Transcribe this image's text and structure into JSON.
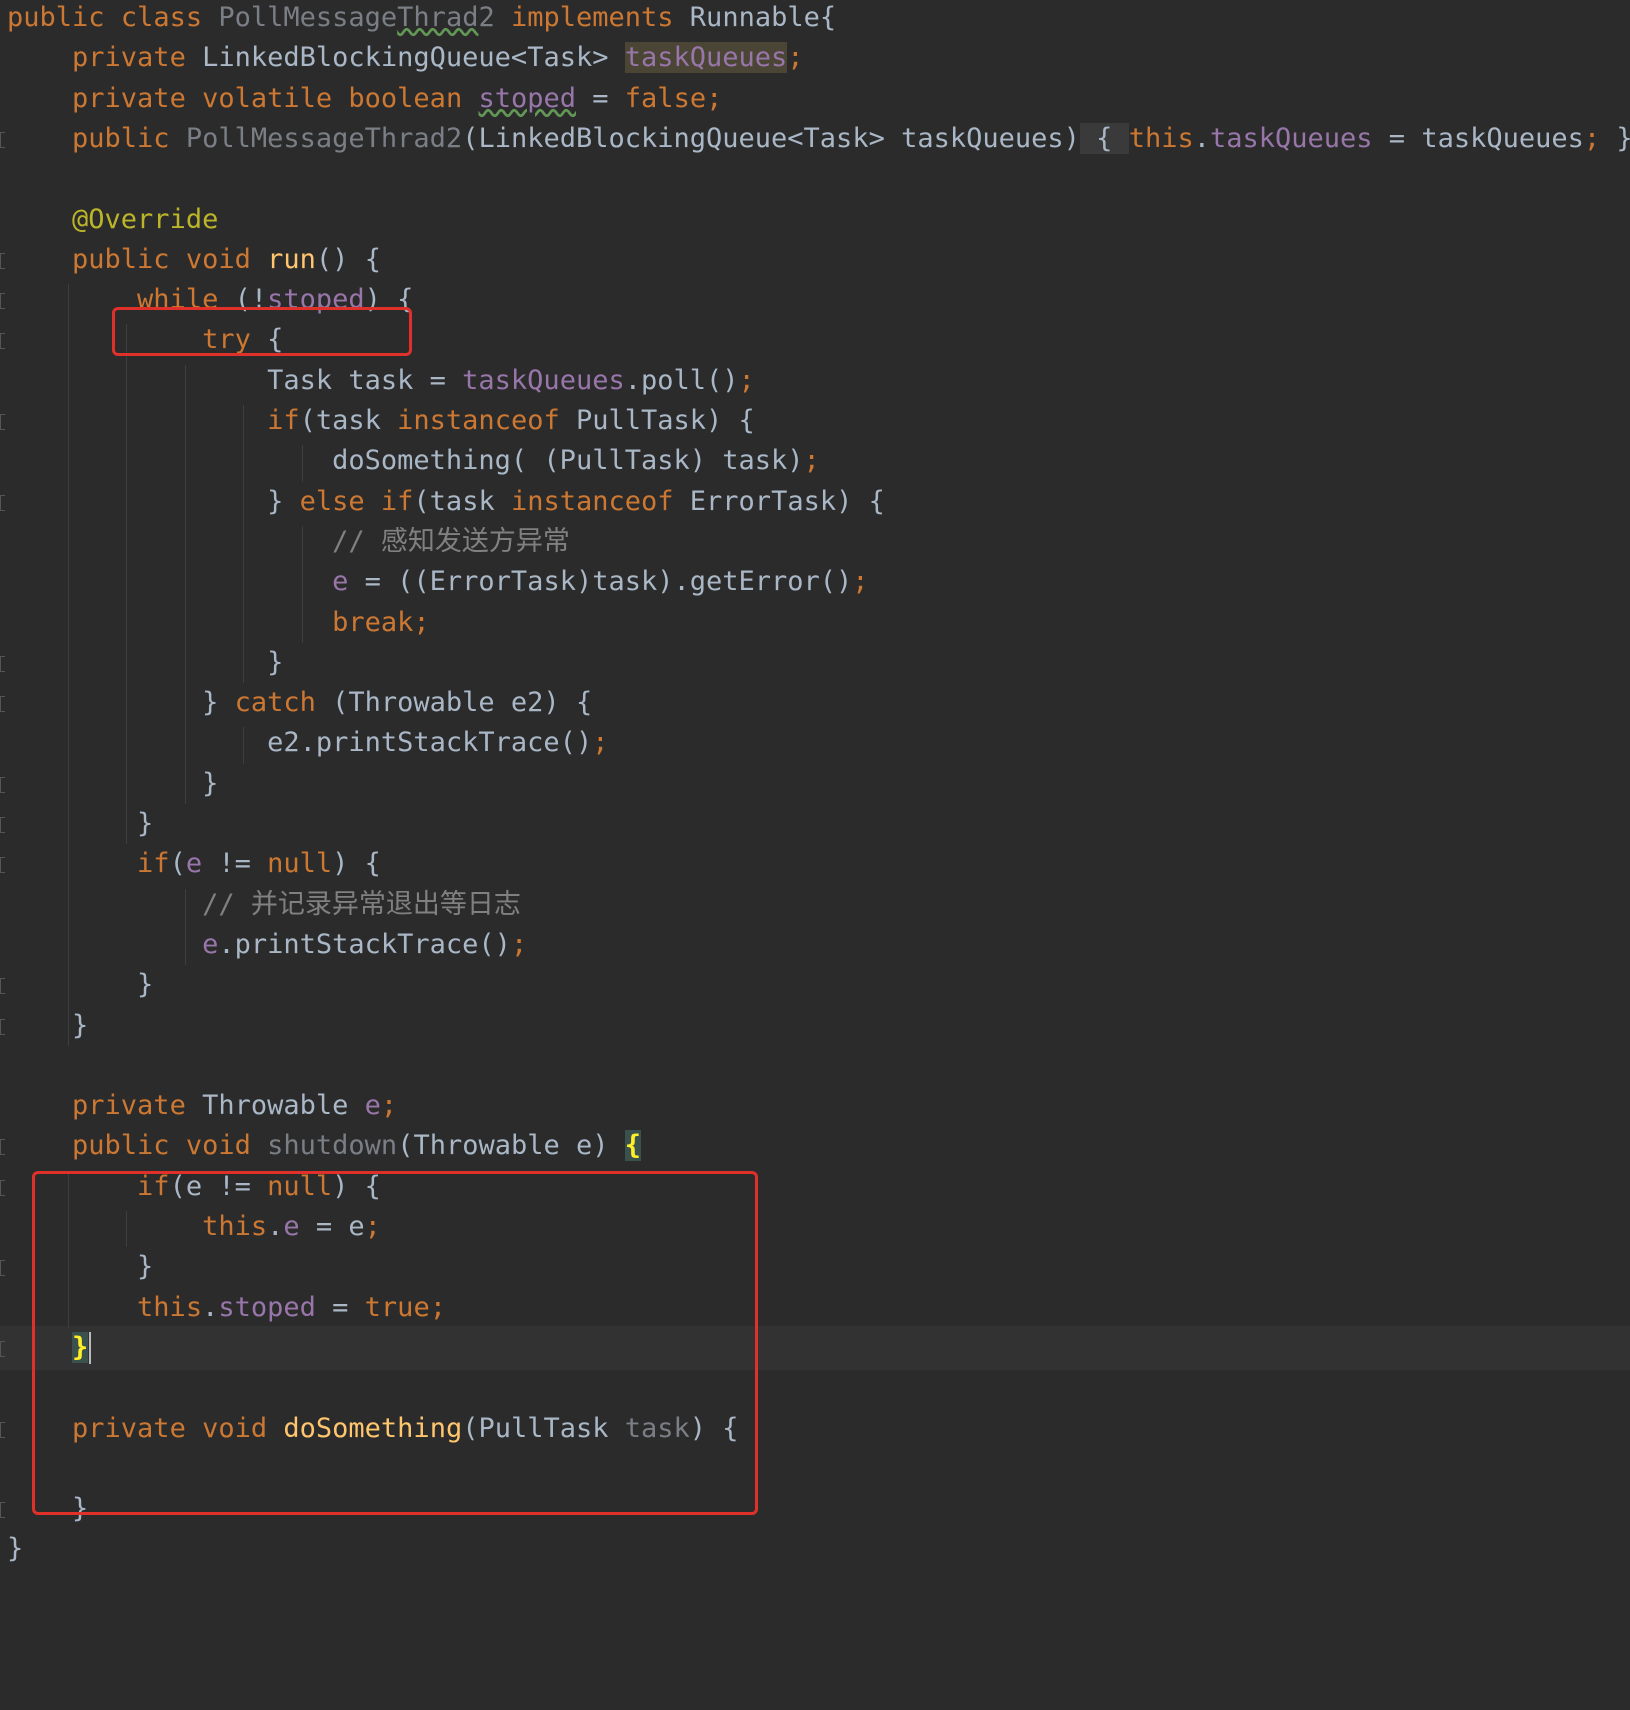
{
  "editor": {
    "language": "Java",
    "colors": {
      "background": "#2b2b2b",
      "keyword": "#cc7832",
      "field": "#9876aa",
      "comment": "#808080",
      "annotation": "#bbb529",
      "method_declaration": "#ffc66d",
      "default_text": "#a9b7c6",
      "highlight_box": "#e0302a"
    },
    "highlights": [
      "while (!stoped) {",
      "private Throwable e; ... shutdown(Throwable e) { ... }"
    ],
    "lines": [
      "public class PollMessageThrad2 implements Runnable{",
      "    private LinkedBlockingQueue<Task> taskQueues;",
      "    private volatile boolean stoped = false;",
      "    public PollMessageThrad2(LinkedBlockingQueue<Task> taskQueues) { this.taskQueues = taskQueues; }",
      "",
      "    @Override",
      "    public void run() {",
      "        while (!stoped) {",
      "            try {",
      "                Task task = taskQueues.poll();",
      "                if(task instanceof PullTask) {",
      "                    doSomething( (PullTask) task);",
      "                } else if(task instanceof ErrorTask) {",
      "                    // 感知发送方异常",
      "                    e = ((ErrorTask)task).getError();",
      "                    break;",
      "                }",
      "            } catch (Throwable e2) {",
      "                e2.printStackTrace();",
      "            }",
      "        }",
      "        if(e != null) {",
      "            // 并记录异常退出等日志",
      "            e.printStackTrace();",
      "        }",
      "    }",
      "",
      "    private Throwable e;",
      "    public void shutdown(Throwable e) {",
      "        if(e != null) {",
      "            this.e = e;",
      "        }",
      "        this.stoped = true;",
      "    }",
      "",
      "    private void doSomething(PullTask task) {",
      "",
      "    }",
      "}"
    ]
  }
}
